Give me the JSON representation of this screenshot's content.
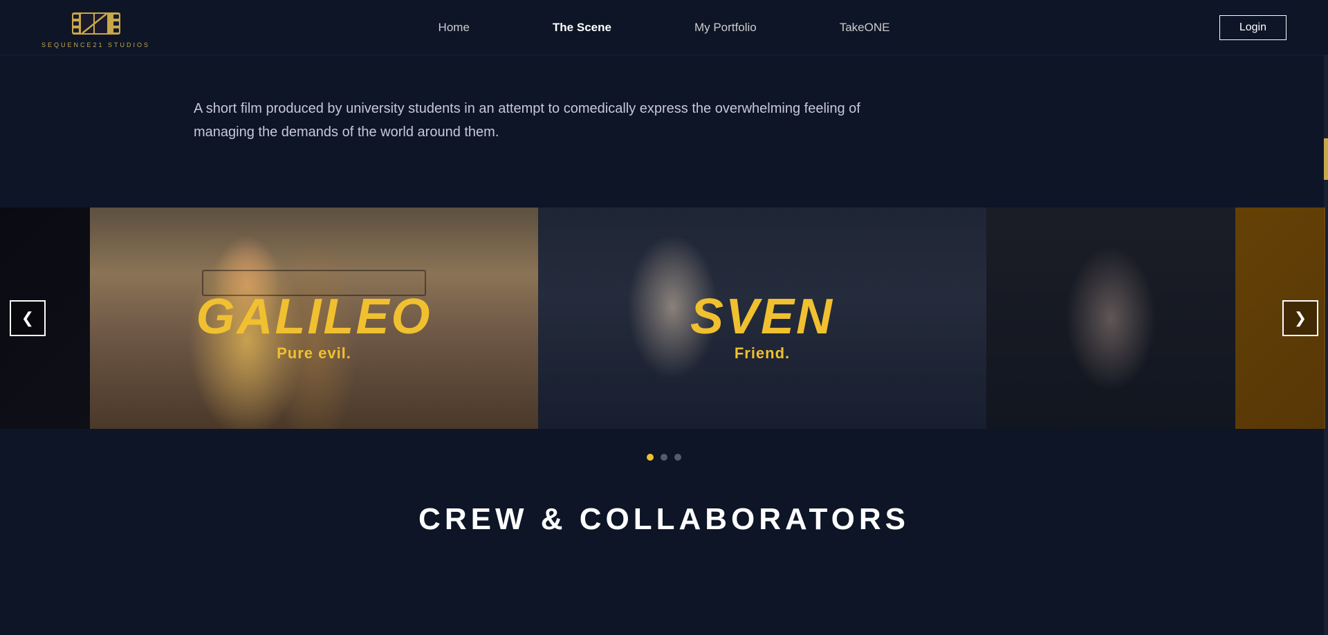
{
  "header": {
    "logo_text": "SEQUENCE21 STUDIOS",
    "nav": {
      "home_label": "Home",
      "scene_label": "The Scene",
      "portfolio_label": "My Portfolio",
      "takeone_label": "TakeONE",
      "login_label": "Login"
    }
  },
  "hero": {
    "description": "A short film produced by university students in an attempt to comedically express the overwhelming feeling of managing the demands of the world around them."
  },
  "carousel": {
    "prev_label": "‹",
    "next_label": "›",
    "slides": [
      {
        "character_name": "GALILEO",
        "character_role": "Pure evil."
      },
      {
        "character_name": "SVEN",
        "character_role": "Friend."
      }
    ],
    "dots": [
      {
        "active": true
      },
      {
        "active": false
      },
      {
        "active": false
      }
    ]
  },
  "crew_section": {
    "title": "CREW & COLLABORATORS"
  },
  "colors": {
    "background": "#0d1527",
    "accent_gold": "#f0c030",
    "logo_gold": "#c8a84b",
    "text_primary": "#ffffff",
    "text_secondary": "#c8c8d8"
  },
  "icons": {
    "prev_arrow": "❮",
    "next_arrow": "❯"
  }
}
